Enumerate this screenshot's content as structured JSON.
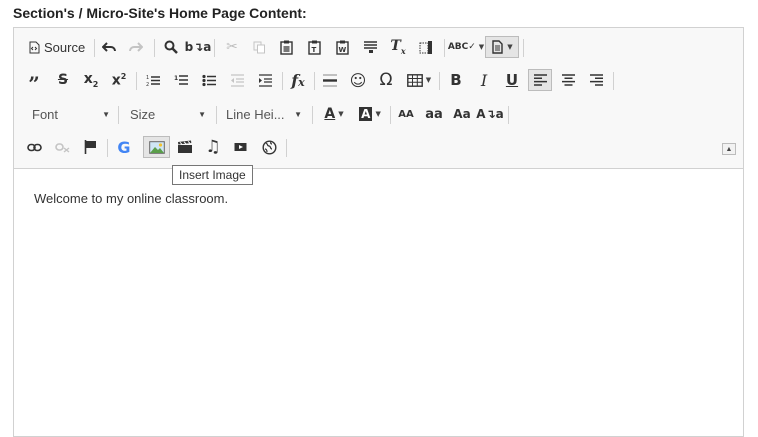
{
  "heading": "Section's / Micro-Site's Home Page Content:",
  "toolbar": {
    "source_label": "Source",
    "font_label": "Font",
    "size_label": "Size",
    "line_height_label": "Line Hei...",
    "large_caps_label": "AA",
    "small_caps_label": "aa",
    "title_case_label": "Aa"
  },
  "tooltip": "Insert Image",
  "content": {
    "text": "Welcome to my online classroom."
  },
  "colors": {
    "toolbar_bg": "#f8f8f8",
    "border": "#d1d1d1",
    "text": "#333333"
  }
}
